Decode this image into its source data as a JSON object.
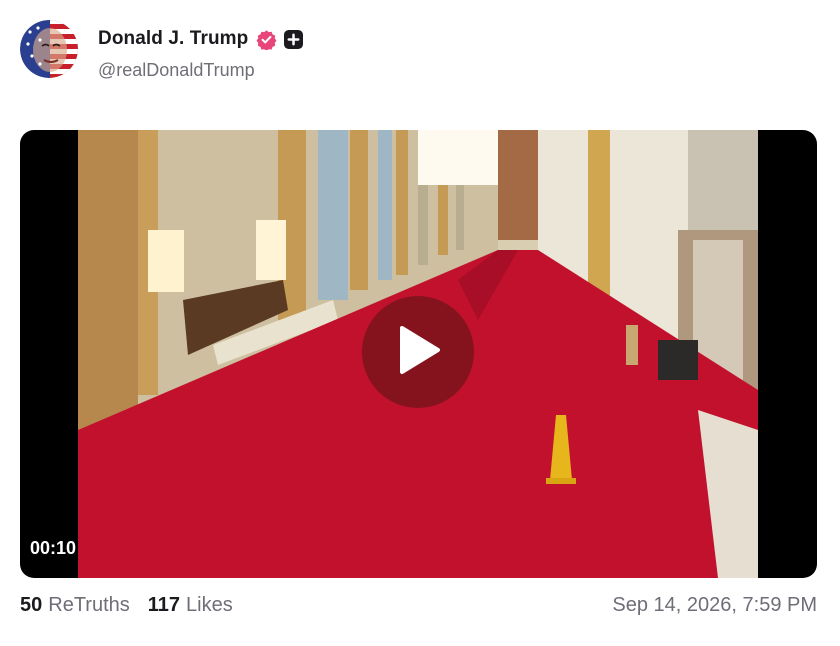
{
  "author": {
    "display_name": "Donald J. Trump",
    "handle": "@realDonaldTrump",
    "verified_icon": "verified-badge-icon",
    "plus_icon": "plus-badge-icon",
    "verified_color": "#e8457a"
  },
  "media": {
    "type": "video",
    "duration": "00:10",
    "play_icon": "play-icon",
    "play_button_color": "#78141a"
  },
  "stats": {
    "retruths_count": "50",
    "retruths_label": "ReTruths",
    "likes_count": "117",
    "likes_label": "Likes"
  },
  "post_date": "Sep 14, 2026, 7:59 PM"
}
